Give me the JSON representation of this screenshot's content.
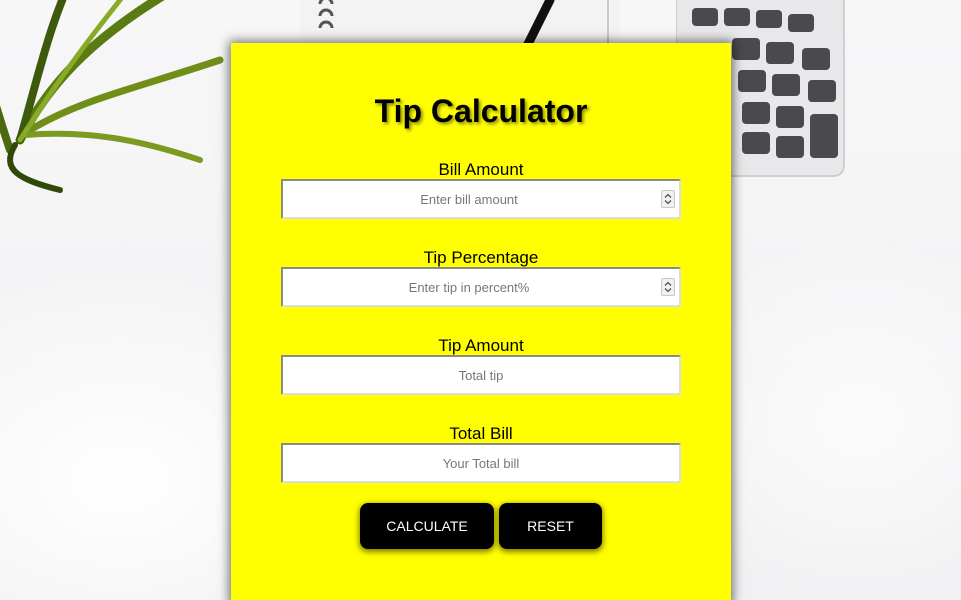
{
  "app": {
    "title": "Tip Calculator"
  },
  "fields": {
    "bill": {
      "label": "Bill Amount",
      "placeholder": "Enter bill amount",
      "value": ""
    },
    "tip_percent": {
      "label": "Tip Percentage",
      "placeholder": "Enter tip in percent%",
      "value": ""
    },
    "tip_amount": {
      "label": "Tip Amount",
      "placeholder": "Total tip",
      "value": ""
    },
    "total_bill": {
      "label": "Total Bill",
      "placeholder": "Your Total bill",
      "value": ""
    }
  },
  "buttons": {
    "calculate_label": "CALCULATE",
    "reset_label": "RESET"
  },
  "colors": {
    "card_background": "#ffff00",
    "button_background": "#000000",
    "button_text": "#ffffff"
  },
  "icons": {
    "number_spinner": "spinner-arrows-icon"
  }
}
